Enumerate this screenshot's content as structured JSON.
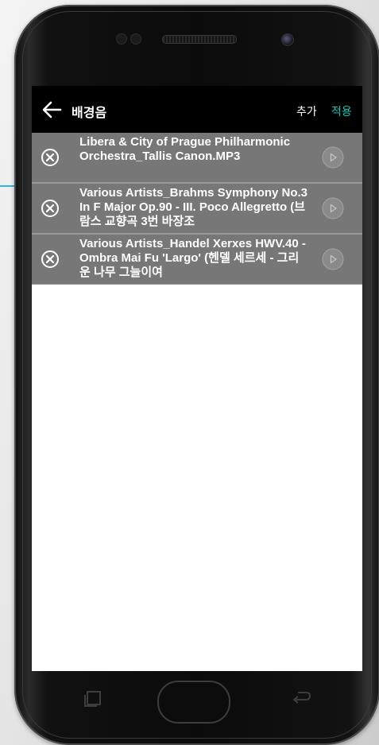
{
  "app_bar": {
    "back_icon": "arrow-left-icon",
    "title": "배경음",
    "add_label": "추가",
    "apply_label": "적용"
  },
  "tracks": [
    {
      "title": "Libera & City of Prague Philharmonic Orchestra_Tallis Canon.MP3",
      "remove_icon": "close-circle-icon",
      "play_icon": "play-circle-icon"
    },
    {
      "title": "Various Artists_Brahms  Symphony No.3 In F Major Op.90 - III. Poco Allegretto (브람스  교향곡 3번 바장조",
      "remove_icon": "close-circle-icon",
      "play_icon": "play-circle-icon"
    },
    {
      "title": "Various Artists_Handel  Xerxes HWV.40 - Ombra Mai Fu 'Largo' (헨델 세르세 - 그리운 나무 그늘이여",
      "remove_icon": "close-circle-icon",
      "play_icon": "play-circle-icon"
    }
  ],
  "colors": {
    "app_bar_bg": "#000000",
    "accent": "#18c6b3",
    "row_bg": "#777777",
    "row_divider": "#9a9a9a",
    "pointer": "#29b6e8"
  },
  "nav_icons": [
    "recents-icon",
    "home-button",
    "back-icon"
  ]
}
